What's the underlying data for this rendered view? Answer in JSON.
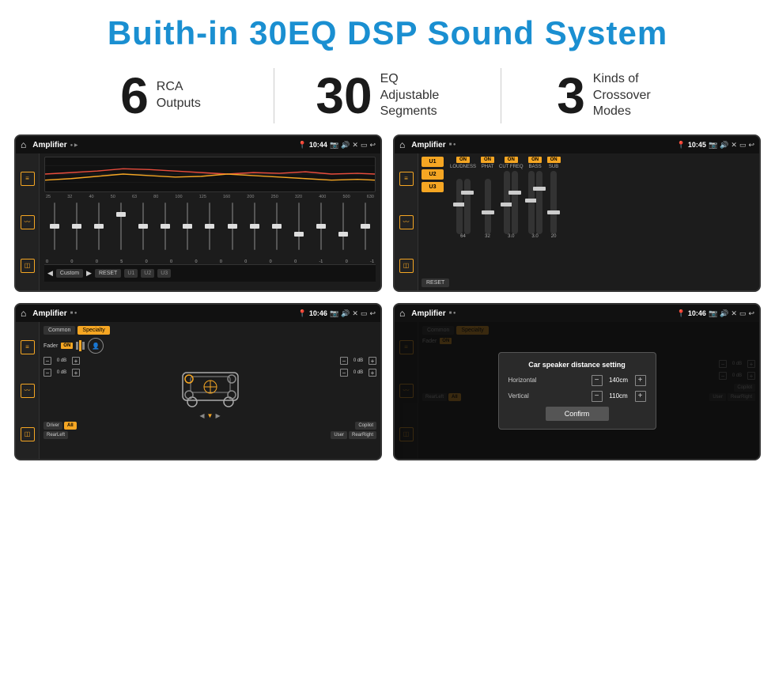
{
  "page": {
    "title": "Buith-in 30EQ DSP Sound System",
    "stats": [
      {
        "number": "6",
        "label": "RCA\nOutputs"
      },
      {
        "number": "30",
        "label": "EQ Adjustable\nSegments"
      },
      {
        "number": "3",
        "label": "Kinds of\nCrossover Modes"
      }
    ]
  },
  "screens": [
    {
      "id": "screen1",
      "status_bar": {
        "app": "Amplifier",
        "time": "10:44",
        "indicators": "▶"
      },
      "type": "eq"
    },
    {
      "id": "screen2",
      "status_bar": {
        "app": "Amplifier",
        "time": "10:45"
      },
      "type": "amp"
    },
    {
      "id": "screen3",
      "status_bar": {
        "app": "Amplifier",
        "time": "10:46"
      },
      "type": "speaker"
    },
    {
      "id": "screen4",
      "status_bar": {
        "app": "Amplifier",
        "time": "10:46"
      },
      "type": "speaker-dialog",
      "dialog": {
        "title": "Car speaker distance setting",
        "horizontal_label": "Horizontal",
        "horizontal_value": "140cm",
        "vertical_label": "Vertical",
        "vertical_value": "110cm",
        "confirm_label": "Confirm"
      }
    }
  ],
  "eq": {
    "freq_labels": [
      "25",
      "32",
      "40",
      "50",
      "63",
      "80",
      "100",
      "125",
      "160",
      "200",
      "250",
      "320",
      "400",
      "500",
      "630"
    ],
    "values": [
      "0",
      "0",
      "0",
      "5",
      "0",
      "0",
      "0",
      "0",
      "0",
      "0",
      "0",
      "-1",
      "0",
      "-1"
    ],
    "presets": [
      "Custom",
      "RESET",
      "U1",
      "U2",
      "U3"
    ],
    "slider_heights": [
      50,
      50,
      50,
      65,
      50,
      50,
      50,
      50,
      50,
      50,
      50,
      38,
      50,
      38
    ]
  },
  "amp": {
    "presets": [
      "U1",
      "U2",
      "U3"
    ],
    "channels": [
      {
        "name": "LOUDNESS",
        "on": true,
        "value": "64"
      },
      {
        "name": "PHAT",
        "on": true,
        "value": "32"
      },
      {
        "name": "CUT FREQ",
        "on": true,
        "value": "3.0"
      },
      {
        "name": "BASS",
        "on": true,
        "value": "3.0"
      },
      {
        "name": "SUB",
        "on": true,
        "value": "20"
      }
    ],
    "reset_btn": "RESET"
  },
  "speaker": {
    "tabs": [
      "Common",
      "Specialty"
    ],
    "fader_label": "Fader",
    "fader_on": true,
    "channels": [
      {
        "value": "0 dB"
      },
      {
        "value": "0 dB"
      },
      {
        "value": "0 dB"
      },
      {
        "value": "0 dB"
      }
    ],
    "buttons": [
      "Driver",
      "All",
      "Copilot",
      "RearLeft",
      "User",
      "RearRight"
    ]
  },
  "dialog": {
    "title": "Car speaker distance setting",
    "horizontal_label": "Horizontal",
    "horizontal_value": "140cm",
    "vertical_label": "Vertical",
    "vertical_value": "110cm",
    "confirm_label": "Confirm"
  }
}
